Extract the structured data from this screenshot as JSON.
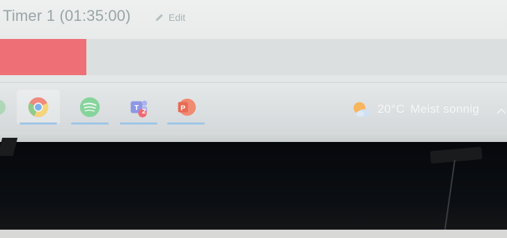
{
  "timer": {
    "title": "Timer 1 (01:35:00)",
    "edit_label": "Edit",
    "progress_fraction": 0.17
  },
  "taskbar": {
    "apps": [
      {
        "name": "Chrome",
        "icon": "chrome-icon",
        "active": true
      },
      {
        "name": "Spotify",
        "icon": "spotify-icon",
        "active": false
      },
      {
        "name": "Microsoft Teams",
        "icon": "teams-icon",
        "badge": "2",
        "active": false
      },
      {
        "name": "PowerPoint",
        "icon": "powerpoint-icon",
        "active": false
      }
    ],
    "weather": {
      "temperature": "20°C",
      "condition": "Meist sonnig",
      "icon": "partly-sunny-icon"
    }
  },
  "colors": {
    "progress_fill": "#ee7076",
    "taskbar_running_indicator": "#9ec6e6"
  }
}
